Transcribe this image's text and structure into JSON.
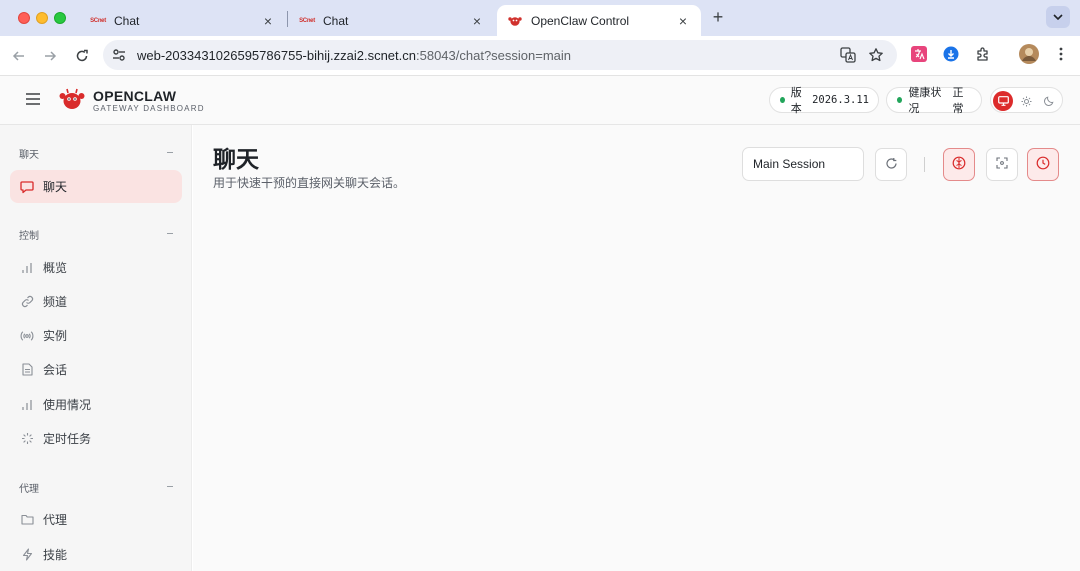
{
  "browser": {
    "tabs": [
      {
        "favicon": "SCnet",
        "title": "Chat",
        "active": false
      },
      {
        "favicon": "SCnet",
        "title": "Chat",
        "active": false
      },
      {
        "favicon": "openclaw-icon",
        "title": "OpenClaw Control",
        "active": true
      }
    ],
    "url_host": "web-2033431026595786755-bihij.zzai2.scnet.cn",
    "url_rest": ":58043/chat?session=main"
  },
  "header": {
    "brand": "OPENCLAW",
    "brand_sub": "GATEWAY DASHBOARD",
    "version_label": "版本",
    "version_value": "2026.3.11",
    "health_label": "健康状况",
    "health_value": "正常",
    "theme_selected": "system"
  },
  "sidebar": {
    "sections": [
      {
        "title": "聊天",
        "items": [
          {
            "label": "聊天",
            "icon": "message-icon",
            "active": true
          }
        ]
      },
      {
        "title": "控制",
        "items": [
          {
            "label": "概览",
            "icon": "bar-chart-icon"
          },
          {
            "label": "频道",
            "icon": "link-icon"
          },
          {
            "label": "实例",
            "icon": "radio-icon"
          },
          {
            "label": "会话",
            "icon": "document-icon"
          },
          {
            "label": "使用情况",
            "icon": "bar-chart-icon"
          },
          {
            "label": "定时任务",
            "icon": "loader-icon"
          }
        ]
      },
      {
        "title": "代理",
        "items": [
          {
            "label": "代理",
            "icon": "folder-icon"
          },
          {
            "label": "技能",
            "icon": "zap-icon"
          }
        ]
      }
    ]
  },
  "main": {
    "title": "聊天",
    "subtitle": "用于快速干预的直接网关聊天会话。",
    "session_select": "Main Session"
  },
  "colors": {
    "accent": "#dc2b2b",
    "accent_soft": "#fae3e2",
    "status_ok": "#22a55b",
    "tabstrip": "#dde3f5"
  }
}
